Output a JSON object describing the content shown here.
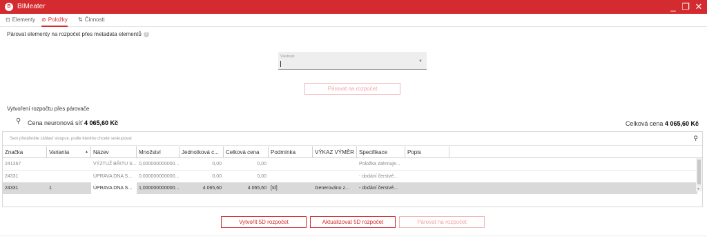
{
  "window": {
    "logo": "B",
    "title": "BIMeater",
    "minimize": "_",
    "maximize": "❐",
    "close": "✕"
  },
  "tabs": [
    {
      "icon": "elements-icon",
      "glyph": "⊡",
      "label": "Elementy"
    },
    {
      "icon": "tag-icon",
      "glyph": "⊘",
      "label": "Položky"
    },
    {
      "icon": "activities-icon",
      "glyph": "⇅",
      "label": "Činnosti"
    }
  ],
  "subtitle": "Párovat elementy na rozpočet přes metadata elementů",
  "property_select": {
    "label": "Vlastnost",
    "value": ""
  },
  "pair_button_top": "Párovat na rozpočet",
  "section_title": "Vytvoření rozpočtu přes párovače",
  "nn_price": {
    "label": "Cena neuronová síť",
    "value": "4 065,60 Kč"
  },
  "total_price": {
    "label": "Celková cena",
    "value": "4 065,60 Kč"
  },
  "grid": {
    "group_hint": "Sem přetáhněte záhlaví sloupce, podle kterého chcete seskupovat",
    "columns": [
      "Značka",
      "Varianta",
      "Název",
      "Množství",
      "Jednotková c...",
      "Celková cena",
      "Podmínka",
      "VÝKAZ VÝMĚR",
      "Specifikace",
      "Popis"
    ],
    "rows": [
      [
        "241367",
        "",
        "VÝZTUŽ BŘITU S...",
        "0,000000000000...",
        "0,00",
        "0,00",
        "",
        "",
        "Položka zahrnuje...",
        ""
      ],
      [
        "24331",
        "",
        "ÚPRAVA DNA S...",
        "0,000000000000...",
        "0,00",
        "0,00",
        "",
        "",
        "- dodání  čerstvé...",
        ""
      ],
      [
        "24331",
        "1",
        "ÚPRAVA DNA S...",
        "1,000000000000...",
        "4 065,60",
        "4 065,60",
        "[Id]",
        "Generováno z...",
        "- dodání  čerstvé...",
        ""
      ]
    ]
  },
  "buttons": {
    "create": "Vytvořit 5D rozpočet",
    "update": "Aktualizovat 5D rozpočet",
    "pair": "Párovat na rozpočet"
  },
  "colors": {
    "accent": "#d32b2f"
  }
}
